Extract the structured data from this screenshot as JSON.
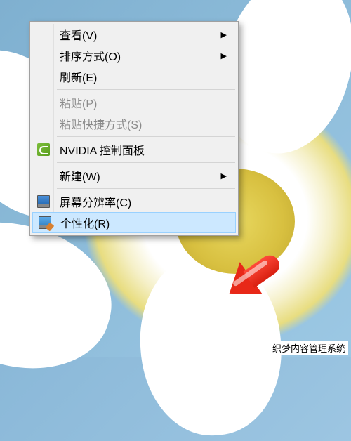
{
  "menu": {
    "items": [
      {
        "label": "查看(V)",
        "has_submenu": true
      },
      {
        "label": "排序方式(O)",
        "has_submenu": true
      },
      {
        "label": "刷新(E)"
      },
      {
        "sep": true
      },
      {
        "label": "粘贴(P)",
        "disabled": true
      },
      {
        "label": "粘贴快捷方式(S)",
        "disabled": true
      },
      {
        "sep": true
      },
      {
        "label": "NVIDIA 控制面板",
        "icon": "nvidia"
      },
      {
        "sep": true
      },
      {
        "label": "新建(W)",
        "has_submenu": true
      },
      {
        "sep": true
      },
      {
        "label": "屏幕分辨率(C)",
        "icon": "screen"
      },
      {
        "label": "个性化(R)",
        "icon": "personalize",
        "highlighted": true
      }
    ]
  },
  "watermark": "织梦内容管理系统"
}
